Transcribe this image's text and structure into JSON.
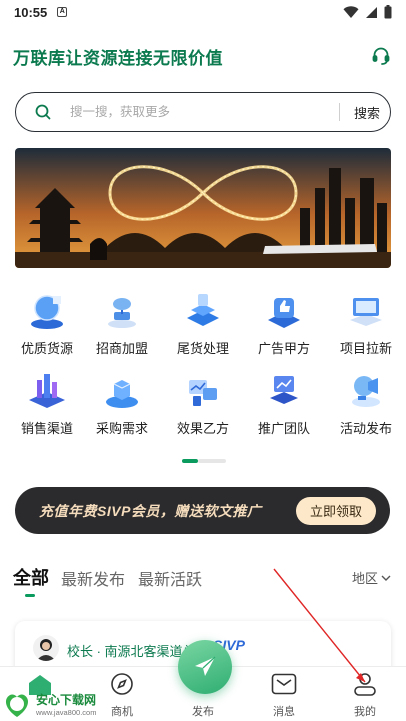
{
  "status_bar": {
    "time": "10:55",
    "notification_letter": "A"
  },
  "header": {
    "slogan": "万联库让资源连接无限价值",
    "support_icon": "headset-icon"
  },
  "search": {
    "placeholder": "搜一搜，获取更多",
    "button_label": "搜索"
  },
  "banner": {
    "description_icon": "infinity-landscape-banner"
  },
  "categories": [
    {
      "label": "优质货源",
      "icon": "globe-gift-icon"
    },
    {
      "label": "招商加盟",
      "icon": "network-cloud-icon"
    },
    {
      "label": "尾货处理",
      "icon": "server-stack-icon"
    },
    {
      "label": "广告甲方",
      "icon": "thumbs-up-icon"
    },
    {
      "label": "项目拉新",
      "icon": "monitor-icon"
    },
    {
      "label": "销售渠道",
      "icon": "city-buildings-icon"
    },
    {
      "label": "采购需求",
      "icon": "cube-box-icon"
    },
    {
      "label": "效果乙方",
      "icon": "chart-devices-icon"
    },
    {
      "label": "推广团队",
      "icon": "laptop-chart-icon"
    },
    {
      "label": "活动发布",
      "icon": "megaphone-icon"
    }
  ],
  "pager": {
    "current": 1,
    "total": 2
  },
  "promo": {
    "text": "充值年费SIVP会员，赠送软文推广",
    "button_label": "立即领取"
  },
  "feed_tabs": [
    {
      "label": "全部",
      "active": true
    },
    {
      "label": "最新发布",
      "active": false
    },
    {
      "label": "最新活跃",
      "active": false
    }
  ],
  "region_filter": {
    "label": "地区"
  },
  "feed_card": {
    "author": "校长 · 南源北客渠道总",
    "badge": "SIVP"
  },
  "bottom_nav": {
    "items": [
      {
        "label": "首页",
        "icon": "home-icon"
      },
      {
        "label": "商机",
        "icon": "compass-icon"
      },
      {
        "label": "发布",
        "icon": "paper-plane-icon"
      },
      {
        "label": "消息",
        "icon": "mail-icon"
      },
      {
        "label": "我的",
        "icon": "user-icon"
      }
    ]
  },
  "watermark": {
    "title": "安心下载网",
    "url": "www.java800.com",
    "logo_text": "安心下载"
  },
  "colors": {
    "brand_green": "#0c7a4f",
    "accent_green": "#0c9b5f",
    "promo_bg": "#2b2a2c",
    "promo_text": "#f4dcbc"
  }
}
